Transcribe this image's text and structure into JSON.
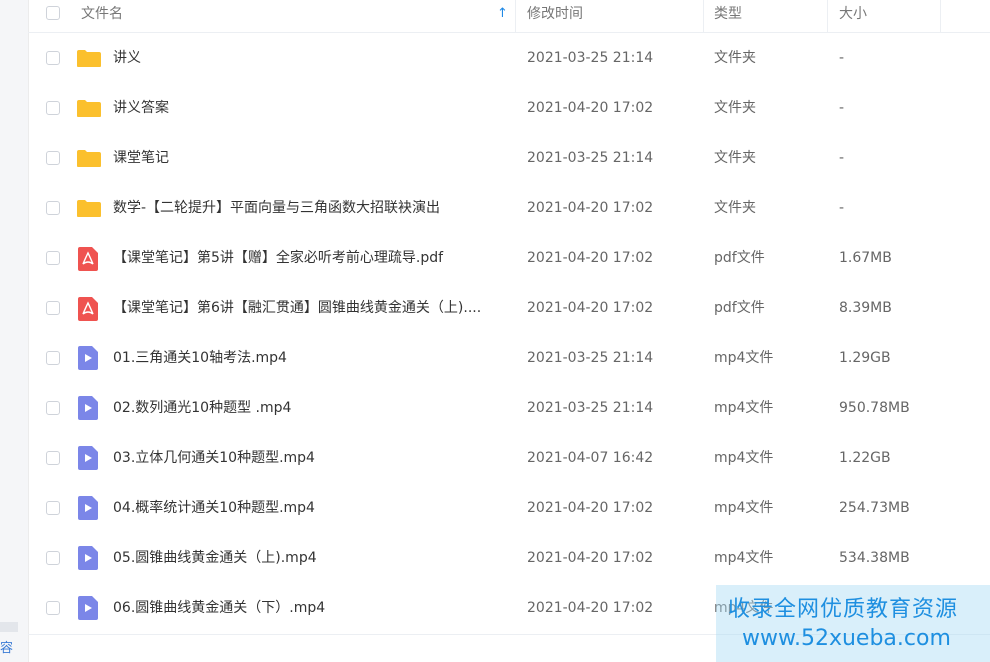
{
  "left_fragment": "容",
  "header": {
    "name": "文件名",
    "sort_icon": "↑",
    "modified": "修改时间",
    "type": "类型",
    "size": "大小"
  },
  "rows": [
    {
      "icon": "folder",
      "name": "讲义",
      "modified": "2021-03-25 21:14",
      "type": "文件夹",
      "size": "-"
    },
    {
      "icon": "folder",
      "name": "讲义答案",
      "modified": "2021-04-20 17:02",
      "type": "文件夹",
      "size": "-"
    },
    {
      "icon": "folder",
      "name": "课堂笔记",
      "modified": "2021-03-25 21:14",
      "type": "文件夹",
      "size": "-"
    },
    {
      "icon": "folder",
      "name": "数学-【二轮提升】平面向量与三角函数大招联袂演出",
      "modified": "2021-04-20 17:02",
      "type": "文件夹",
      "size": "-"
    },
    {
      "icon": "pdf",
      "name": "【课堂笔记】第5讲【赠】全家必听考前心理疏导.pdf",
      "modified": "2021-04-20 17:02",
      "type": "pdf文件",
      "size": "1.67MB"
    },
    {
      "icon": "pdf",
      "name": "【课堂笔记】第6讲【融汇贯通】圆锥曲线黄金通关（上)....",
      "modified": "2021-04-20 17:02",
      "type": "pdf文件",
      "size": "8.39MB"
    },
    {
      "icon": "video",
      "name": "01.三角通关10轴考法.mp4",
      "modified": "2021-03-25 21:14",
      "type": "mp4文件",
      "size": "1.29GB"
    },
    {
      "icon": "video",
      "name": "02.数列通光10种题型 .mp4",
      "modified": "2021-03-25 21:14",
      "type": "mp4文件",
      "size": "950.78MB"
    },
    {
      "icon": "video",
      "name": "03.立体几何通关10种题型.mp4",
      "modified": "2021-04-07 16:42",
      "type": "mp4文件",
      "size": "1.22GB"
    },
    {
      "icon": "video",
      "name": "04.概率统计通关10种题型.mp4",
      "modified": "2021-04-20 17:02",
      "type": "mp4文件",
      "size": "254.73MB"
    },
    {
      "icon": "video",
      "name": "05.圆锥曲线黄金通关（上).mp4",
      "modified": "2021-04-20 17:02",
      "type": "mp4文件",
      "size": "534.38MB"
    },
    {
      "icon": "video",
      "name": "06.圆锥曲线黄金通关（下）.mp4",
      "modified": "2021-04-20 17:02",
      "type": "mp4文件",
      "size": ""
    }
  ],
  "watermark": {
    "line1": "收录全网优质教育资源",
    "line2": "www.52xueba.com"
  },
  "colors": {
    "folder": "#fbc02d",
    "pdf": "#ef5350",
    "video": "#7b86e8",
    "accent": "#1e88e5"
  }
}
